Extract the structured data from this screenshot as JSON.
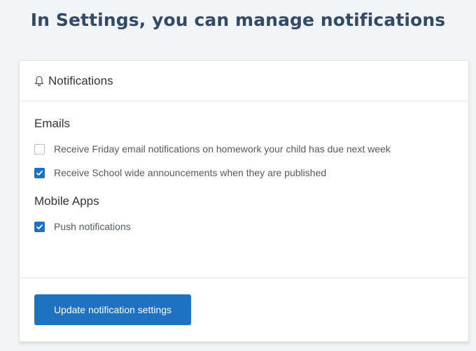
{
  "headline": "In Settings, you can manage notifications",
  "card": {
    "title": "Notifications",
    "icon": "bell-icon",
    "sections": [
      {
        "title": "Emails",
        "options": [
          {
            "label": "Receive Friday email notifications on homework your child has due next week",
            "checked": false
          },
          {
            "label": "Receive School wide announcements when they are published",
            "checked": true
          }
        ]
      },
      {
        "title": "Mobile Apps",
        "options": [
          {
            "label": "Push notifications",
            "checked": true
          }
        ]
      }
    ],
    "button_label": "Update notification settings"
  },
  "colors": {
    "headline": "#314a68",
    "accent": "#1f71c2",
    "checkbox_checked": "#1a73c8"
  }
}
